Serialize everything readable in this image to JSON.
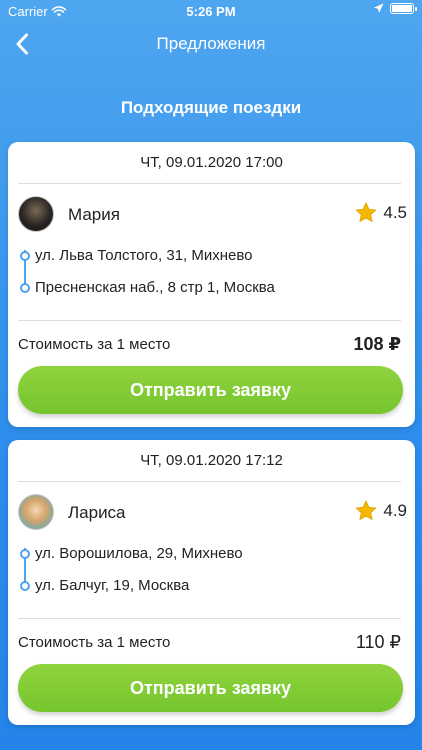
{
  "status_bar": {
    "carrier": "Carrier",
    "time": "5:26 PM"
  },
  "nav": {
    "title": "Предложения"
  },
  "section_title": "Подходящие поездки",
  "trips": [
    {
      "datetime": "ЧТ, 09.01.2020 17:00",
      "driver": "Мария",
      "rating": "4.5",
      "from": "ул. Льва Толстого, 31, Михнево",
      "to": "Пресненская наб., 8 стр 1, Москва",
      "price_label": "Стоимость за 1 место",
      "price": "108 ₽",
      "button": "Отправить заявку"
    },
    {
      "datetime": "ЧТ, 09.01.2020 17:12",
      "driver": "Лариса",
      "rating": "4.9",
      "from": "ул. Ворошилова, 29, Михнево",
      "to": "ул. Балчуг, 19, Москва",
      "price_label": "Стоимость за 1 место",
      "price": "110 ₽",
      "button": "Отправить заявку"
    }
  ],
  "colors": {
    "accent_blue": "#2e8fec",
    "button_green": "#7ac830",
    "star": "#f5b800"
  }
}
